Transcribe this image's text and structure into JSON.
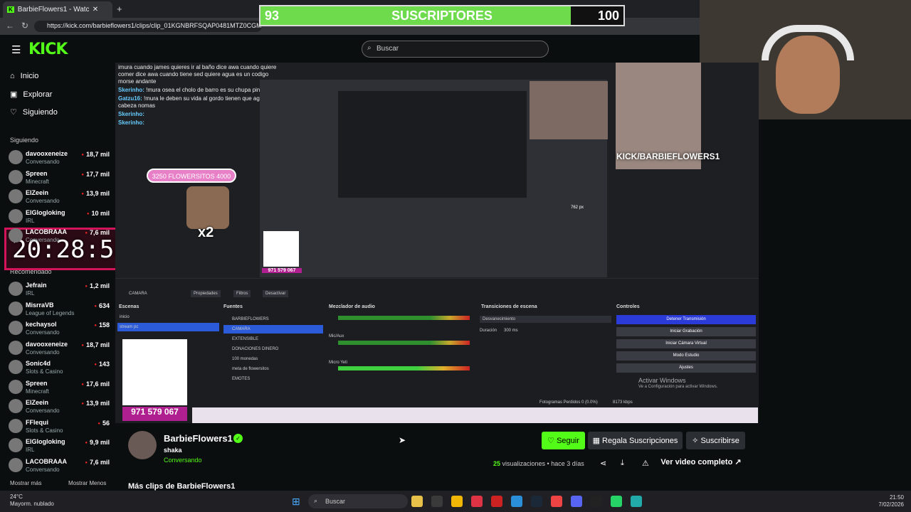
{
  "browser": {
    "tab_title": "BarbieFlowers1 - Watch clip",
    "url": "https://kick.com/barbieflowers1/clips/clip_01KGNBRFSQAP0481MTZ0CGMVAP"
  },
  "overlay": {
    "sub_current": "93",
    "sub_label": "SUSCRIPTORES",
    "sub_goal": "100",
    "sub_progress": 0.93,
    "timer": "20:28:58",
    "flower_bar": "3250 FLOWERSITOS 4000",
    "x2": "x2",
    "cam_tag": "KICK/BARBIEFLOWERS1",
    "qr_phone": "971 579 067",
    "qr_phone_small": "971 579 067",
    "chat": [
      {
        "user": "",
        "text": "imura cuando james quieres ir al baño dice awa cuando quiere comer dice awa cuando tiene sed quiere agua es un codigo morse andante"
      },
      {
        "user": "Skerinho:",
        "text": "!mura osea el cholo de barro es su chupa pinga"
      },
      {
        "user": "Gatzu16:",
        "text": "!mura le deben su vida al gordo tienen que agachar la cabeza nomas"
      },
      {
        "user": "Skerinho:",
        "text": ""
      },
      {
        "user": "Skerinho:",
        "text": ""
      }
    ],
    "activar_windows": "Activar Windows",
    "activar_windows_sub": "Ve a Configuración para activar Windows.",
    "obs_frames": "Fotogramas Perdidos 0 (0.0%)",
    "obs_kbps": "8173 kbps",
    "resolution": "762 px"
  },
  "obs": {
    "headers": [
      "Escenas",
      "Fuentes",
      "Mezclador de audio",
      "Transiciones de escena",
      "Controles"
    ],
    "scenes": [
      "inicio",
      "stream pc"
    ],
    "sources": [
      "BARBIEFLOWERS",
      "CAMARA",
      "EXTENSIBLE",
      "DONACIONES DINERO",
      "100 monedas",
      "meta de flowersitos",
      "EMOTES"
    ],
    "transition": "Desvanecimiento",
    "duration_label": "Duración",
    "duration_value": "300 ms",
    "controls": [
      "Detener Transmisión",
      "Iniciar Grabación",
      "Iniciar Cámara Virtual",
      "Modo Estudio",
      "Ajustes"
    ],
    "camara_label": "CAMARA",
    "props": "Propiedades",
    "filters": "Filtros",
    "deactivate": "Desactivar",
    "mixer_channels": [
      "Mic/Aux",
      "Micro Yeti"
    ]
  },
  "header": {
    "logo": "KICK",
    "search_placeholder": "Buscar"
  },
  "sidebar": {
    "nav": [
      {
        "label": "Inicio",
        "icon": "home-icon"
      },
      {
        "label": "Explorar",
        "icon": "compass-icon"
      },
      {
        "label": "Siguiendo",
        "icon": "heart-icon"
      }
    ],
    "following_title": "Siguiendo",
    "recommended_title": "Recomendado",
    "following": [
      {
        "name": "davooxeneize",
        "game": "Conversando",
        "viewers": "18,7 mil"
      },
      {
        "name": "Spreen",
        "game": "Minecraft",
        "viewers": "17,7 mil"
      },
      {
        "name": "ElZeein",
        "game": "Conversando",
        "viewers": "13,9 mil"
      },
      {
        "name": "ElGlogloking",
        "game": "IRL",
        "viewers": "10 mil"
      },
      {
        "name": "LACOBRAAA",
        "game": "Conversando",
        "viewers": "7,6 mil"
      }
    ],
    "recommended": [
      {
        "name": "Jefrain",
        "game": "IRL",
        "viewers": "1,2 mil"
      },
      {
        "name": "MisrraVB",
        "game": "League of Legends",
        "viewers": "634"
      },
      {
        "name": "kechaysol",
        "game": "Conversando",
        "viewers": "158"
      },
      {
        "name": "davooxeneize",
        "game": "Conversando",
        "viewers": "18,7 mil"
      },
      {
        "name": "Sonic4d",
        "game": "Slots & Casino",
        "viewers": "143"
      },
      {
        "name": "Spreen",
        "game": "Minecraft",
        "viewers": "17,6 mil"
      },
      {
        "name": "ElZeein",
        "game": "Conversando",
        "viewers": "13,9 mil"
      },
      {
        "name": "FFlequi",
        "game": "Slots & Casino",
        "viewers": "56"
      },
      {
        "name": "ElGlogloking",
        "game": "IRL",
        "viewers": "9,9 mil"
      },
      {
        "name": "LACOBRAAA",
        "game": "Conversando",
        "viewers": "7,6 mil"
      }
    ],
    "show_more": "Mostrar más",
    "show_less": "Mostrar Menos"
  },
  "channel": {
    "name": "BarbieFlowers1",
    "subtitle": "shaka",
    "status": "Conversando",
    "follow": "Seguir",
    "gift": "Regala Suscripciones",
    "subscribe": "Suscribirse",
    "views_count": "25",
    "views_text": "visualizaciones • hace 3 días",
    "full_video": "Ver video completo",
    "more_clips": "Más clips de BarbieFlowers1"
  },
  "taskbar": {
    "temp": "24°C",
    "weather": "Mayorm. nublado",
    "search": "Buscar",
    "time": "21:50",
    "date": "7/02/2026"
  },
  "colors": {
    "kick_green": "#53fc18",
    "timer_border": "#d4145a",
    "sub_fill": "#6edb4c"
  }
}
